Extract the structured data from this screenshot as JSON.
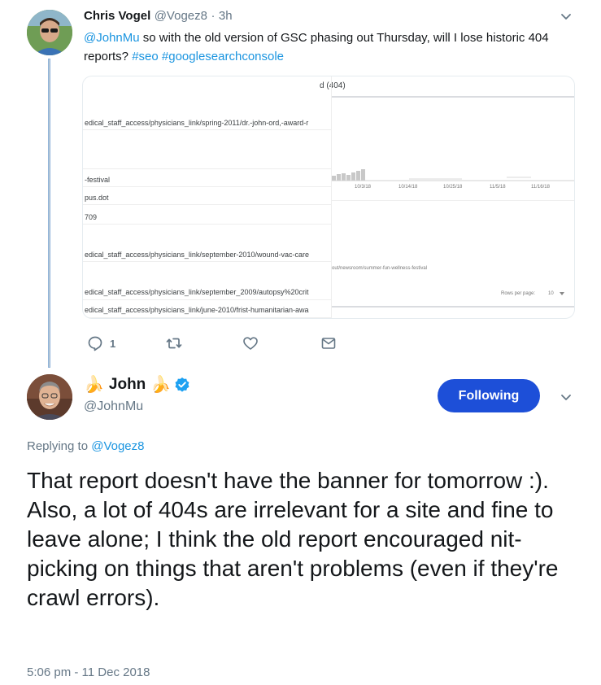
{
  "parent_tweet": {
    "name": "Chris Vogel",
    "handle": "@Vogez8",
    "separator": "·",
    "time": "3h",
    "mention": "@JohnMu",
    "text": " so with the old version of GSC phasing out Thursday, will I lose historic 404 reports? ",
    "hashtag1": "#seo",
    "hashtag2": "#googlesearchconsole",
    "replies_count": "1"
  },
  "embedded_screenshot": {
    "header": "d (404)",
    "left_rows": [
      "edical_staff_access/physicians_link/spring-2011/dr.-john-ord,-award-r",
      "-festival",
      "pus.dot",
      "709",
      "edical_staff_access/physicians_link/september-2010/wound-vac-care",
      "edical_staff_access/physicians_link/september_2009/autopsy%20crit",
      "edical_staff_access/physicians_link/june-2010/frist-humanitarian-awa"
    ],
    "axis_dates": [
      "10/3/18",
      "10/14/18",
      "10/25/18",
      "11/5/18",
      "11/16/18"
    ],
    "url_row": "out/newsroom/summer-fun-wellness-festival",
    "rows_per_page_label": "Rows per page:",
    "rows_per_page_value": "10"
  },
  "reply_tweet": {
    "emoji_left": "🍌",
    "name": "John",
    "emoji_right": "🍌",
    "handle": "@JohnMu",
    "follow_label": "Following",
    "replying_prefix": "Replying to ",
    "replying_to": "@Vogez8",
    "text": "That report doesn't have the banner for tomorrow :). Also, a lot of 404s are irrelevant for a site and fine to leave alone; I think the old report encouraged nit-picking on things that aren't problems (even if they're crawl errors).",
    "timestamp": "5:06 pm - 11 Dec 2018"
  },
  "colors": {
    "link": "#1b95e0",
    "follow_button": "#1d4fd8",
    "secondary_text": "#657786",
    "verified": "#1da1f2"
  },
  "icons": [
    "reply-icon",
    "retweet-icon",
    "like-icon",
    "message-icon",
    "chevron-down-icon",
    "verified-badge-icon"
  ]
}
